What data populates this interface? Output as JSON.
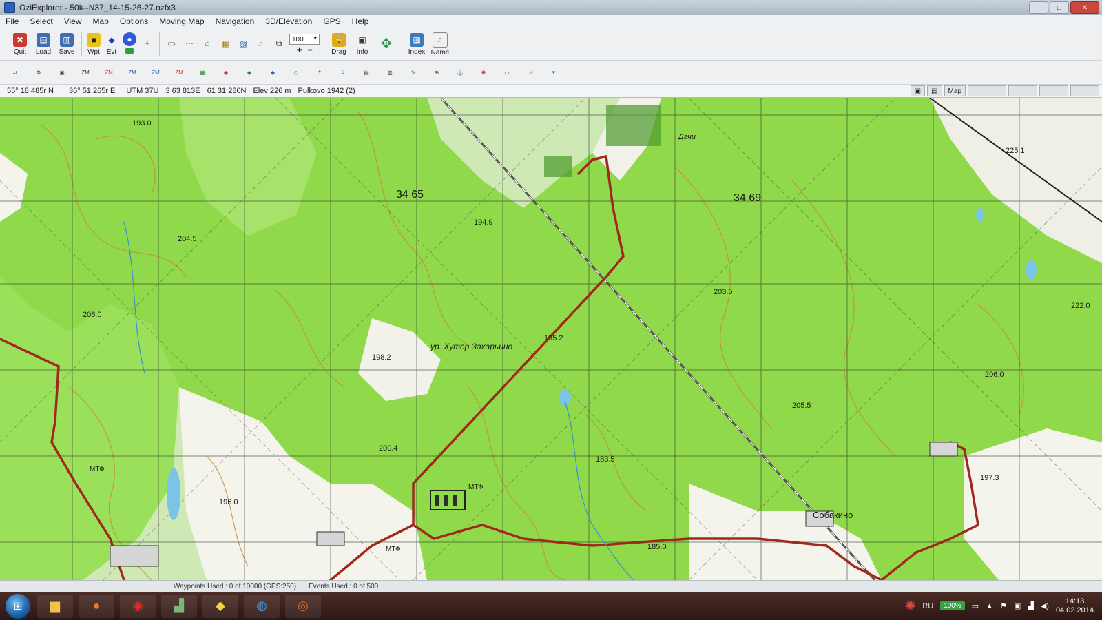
{
  "window": {
    "title": "OziExplorer - 50k--N37_14-15-26-27.ozfx3",
    "buttons": [
      "–",
      "□",
      "✕"
    ]
  },
  "menu": [
    "File",
    "Select",
    "View",
    "Map",
    "Options",
    "Moving Map",
    "Navigation",
    "3D/Elevation",
    "GPS",
    "Help"
  ],
  "toolbar1": {
    "quit": "Quit",
    "load": "Load",
    "save": "Save",
    "wpt": "Wpt",
    "evt": "Evt",
    "zoom_value": "100",
    "drag": "Drag",
    "info": "Info",
    "index": "Index",
    "name": "Name"
  },
  "coords": {
    "lat": "55° 18,485r N",
    "lon": "36° 51,265r E",
    "utm": "UTM  37U",
    "easting": "3 63 813E",
    "northing": "61 31 280N",
    "elev": "Elev 226 m",
    "datum": "Pulkovo 1942 (2)",
    "map_tab": "Map"
  },
  "map_labels": {
    "grid_34_65": "34 65",
    "grid_34_69": "34 69",
    "spot_193": "193.0",
    "spot_204": "204.5",
    "spot_206": "206.0",
    "spot_198": "198.2",
    "spot_195": "195.2",
    "spot_194": "194.9",
    "spot_200": "200.4",
    "spot_203": "203.5",
    "spot_205": "205.5",
    "spot_225": "225.1",
    "spot_222": "222.0",
    "spot_206b": "206.0",
    "spot_197": "197.3",
    "spot_185": "185.0",
    "spot_183": "183.5",
    "spot_196": "196.0",
    "place_hutor": "ур. Хутор Захарьино",
    "place_dachi": "Дачи",
    "place_sobakino": "Собакино",
    "place_mtf1": "МТФ",
    "place_mtf2": "МТФ",
    "place_mtf3": "МТФ"
  },
  "status": {
    "waypoints": "Waypoints Used : 0 of 10000  (GPS:250)",
    "events": "Events Used : 0 of 500"
  },
  "taskbar": {
    "lang": "RU",
    "battery": "100%",
    "time": "14:13",
    "date": "04.02.2014"
  }
}
